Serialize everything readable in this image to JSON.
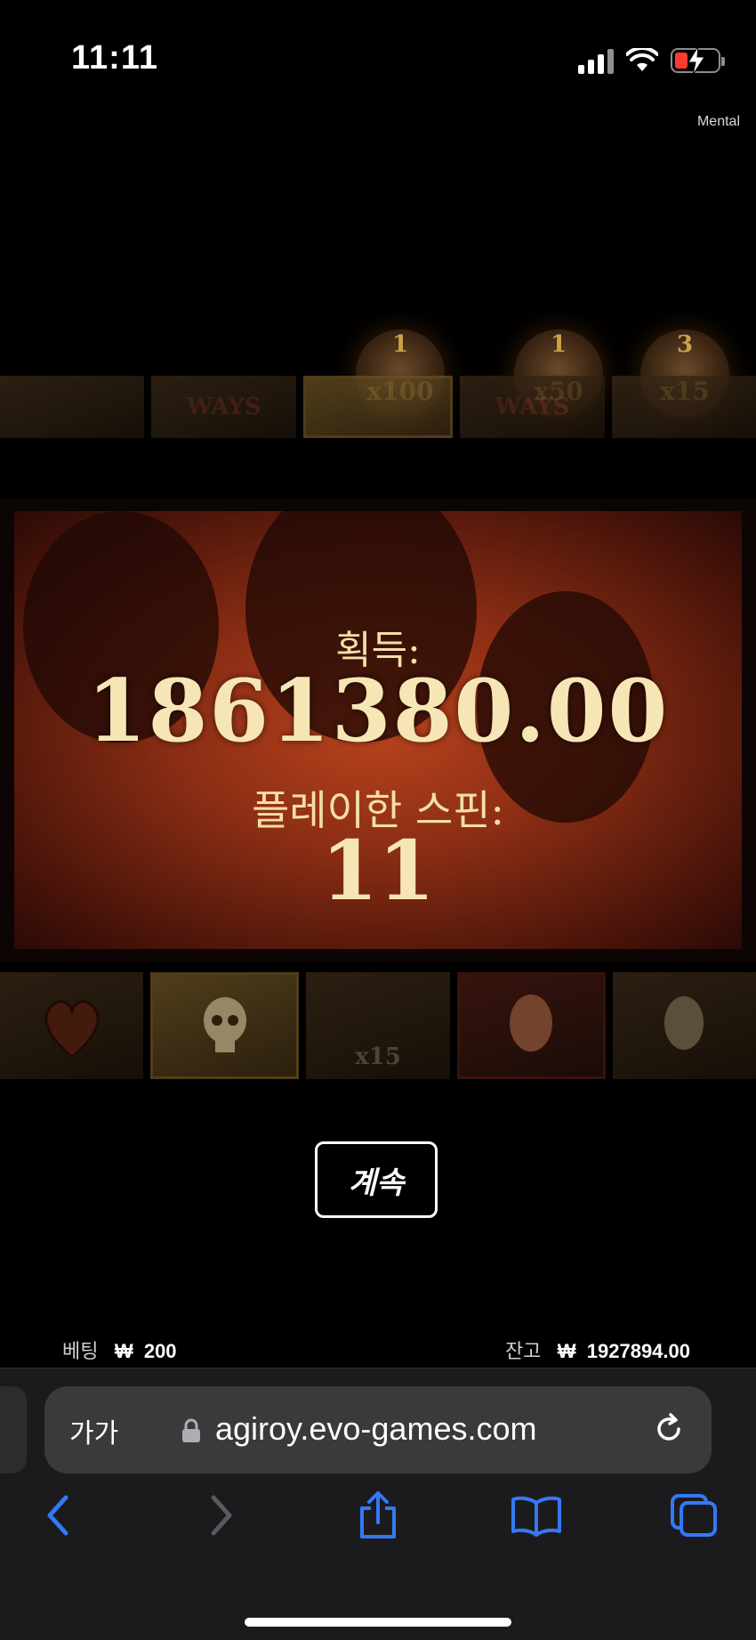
{
  "status_bar": {
    "time": "11:11",
    "icons": [
      "cellular-signal-icon",
      "wifi-icon",
      "battery-charging-icon"
    ]
  },
  "game": {
    "watermark": "Mental",
    "multipliers": [
      {
        "count": "1",
        "label": "x100"
      },
      {
        "count": "1",
        "label": "x50"
      },
      {
        "count": "3",
        "label": "x15"
      }
    ],
    "top_reel_text": [
      "WAYS",
      "WAYS"
    ],
    "bottom_reel_text": [
      "x15"
    ],
    "win_panel": {
      "win_label": "획득:",
      "win_amount": "1861380.00",
      "spins_label": "플레이한 스핀:",
      "spins_value": "11"
    },
    "continue_label": "계속",
    "bet": {
      "label": "베팅",
      "currency": "₩",
      "value": "200"
    },
    "balance": {
      "label": "잔고",
      "currency": "₩",
      "value": "1927894.00"
    }
  },
  "browser": {
    "text_size_label": "가가",
    "url": "agiroy.evo-games.com",
    "toolbar_icons": [
      "back-icon",
      "forward-icon",
      "share-icon",
      "bookmarks-icon",
      "tabs-icon"
    ],
    "accent": "#3478f6"
  }
}
